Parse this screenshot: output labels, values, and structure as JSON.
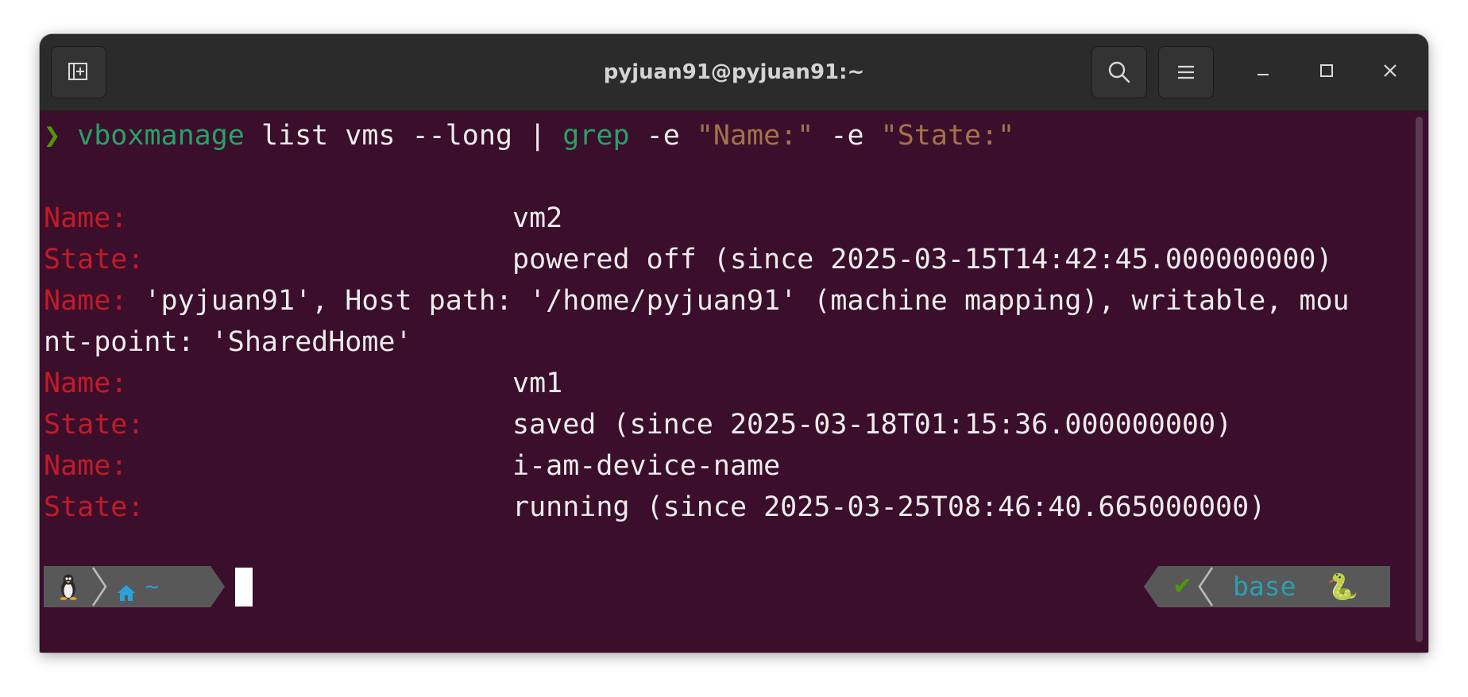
{
  "window": {
    "title": "pyjuan91@pyjuan91:~",
    "buttons": {
      "new_tab": "new-tab-icon",
      "search": "search-icon",
      "menu": "hamburger-menu-icon",
      "minimize": "minimize-icon",
      "maximize": "maximize-icon",
      "close": "close-icon"
    }
  },
  "colors": {
    "terminal_bg": "#3b0e2b",
    "titlebar_bg": "#2b2b2b",
    "label_red": "#c01c28",
    "command_green": "#26a269",
    "string_tan": "#a2734c",
    "prompt_green": "#4e9a06",
    "powerline_gray": "#585858",
    "accent_blue": "#2aa1b3"
  },
  "command": {
    "prompt": "❯",
    "program": "vboxmanage",
    "args": " list vms --long | ",
    "grep": "grep",
    "flag1": " -e ",
    "pattern1": "\"Name:\"",
    "flag2": " -e ",
    "pattern2": "\"State:\""
  },
  "output": [
    {
      "label": "Name:",
      "text": "                       vm2"
    },
    {
      "label": "State:",
      "text": "                      powered off (since 2025-03-15T14:42:45.000000000)"
    },
    {
      "label": "Name:",
      "text": " 'pyjuan91', Host path: '/home/pyjuan91' (machine mapping), writable, mou"
    },
    {
      "label": "",
      "text": "nt-point: 'SharedHome'"
    },
    {
      "label": "Name:",
      "text": "                       vm1"
    },
    {
      "label": "State:",
      "text": "                      saved (since 2025-03-18T01:15:36.000000000)"
    },
    {
      "label": "Name:",
      "text": "                       i-am-device-name"
    },
    {
      "label": "State:",
      "text": "                      running (since 2025-03-25T08:46:40.665000000)"
    }
  ],
  "prompt_line": {
    "os_icon": "linux-penguin-icon",
    "home_icon": "home-icon",
    "directory": "~",
    "status_icon": "checkmark-icon",
    "status_glyph": "✔",
    "env_name": "base",
    "env_icon": "python-snake-icon",
    "env_glyph": "🐍"
  }
}
